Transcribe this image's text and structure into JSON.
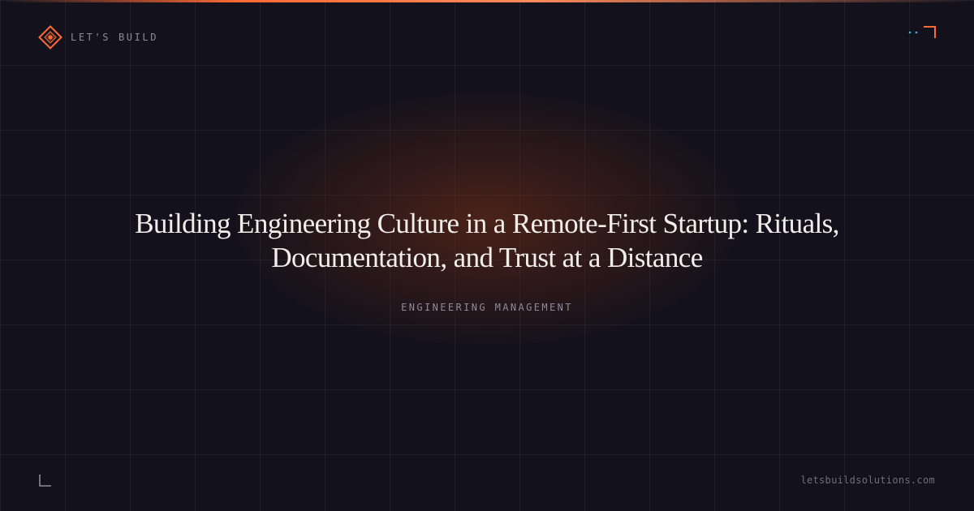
{
  "brand": {
    "name": "LET'S BUILD",
    "icon": "diamond-logo-icon"
  },
  "post": {
    "title": "Building Engineering Culture in a Remote-First Startup: Rituals, Documentation, and Trust at a Distance",
    "category": "ENGINEERING MANAGEMENT"
  },
  "footer": {
    "url": "letsbuildsolutions.com"
  },
  "colors": {
    "background": "#13121c",
    "accent": "#ff6b35",
    "secondary_accent": "#3fb6d8",
    "title_text": "#f1eeea",
    "muted_text": "#8d8b9a"
  },
  "decorations": {
    "top_right": "corner-bracket-icon",
    "bottom_left": "corner-bracket-icon"
  }
}
